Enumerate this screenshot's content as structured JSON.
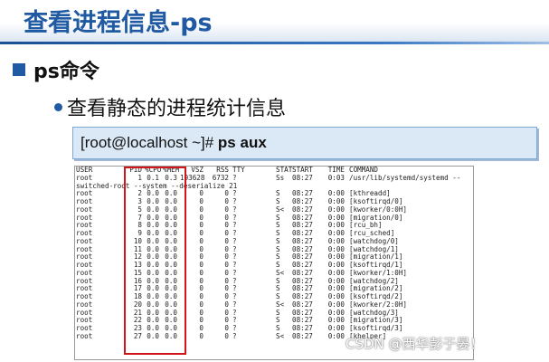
{
  "slide": {
    "title": "查看进程信息-ps",
    "bullet1": "ps命令",
    "bullet2": "查看静态的进程统计信息",
    "command_prefix": "[root@localhost ~]# ",
    "command_strong": "ps aux",
    "watermark": "CSDN @西华彭于晏！"
  },
  "colors": {
    "title_blue": "#1f5aa3",
    "command_box_bg": "#dbe8f6",
    "highlight_red": "#d0161b"
  },
  "terminal": {
    "headers": [
      "USER",
      "PID",
      "%CPU",
      "%MEM",
      "VSZ",
      "RSS",
      "TTY",
      "STAT",
      "START",
      "TIME",
      "COMMAND"
    ],
    "rows": [
      {
        "user": "root",
        "pid": "1",
        "cpu": "0.1",
        "mem": "0.3",
        "vsz": "193628",
        "rss": "6732",
        "tty": "?",
        "stat": "Ss",
        "start": "08:27",
        "time": "0:03",
        "cmd": "/usr/lib/systemd/systemd --"
      },
      {
        "wrap": "switched-root --system --deserialize 21"
      },
      {
        "user": "root",
        "pid": "2",
        "cpu": "0.0",
        "mem": "0.0",
        "vsz": "0",
        "rss": "0",
        "tty": "?",
        "stat": "S",
        "start": "08:27",
        "time": "0:00",
        "cmd": "[kthreadd]"
      },
      {
        "user": "root",
        "pid": "3",
        "cpu": "0.0",
        "mem": "0.0",
        "vsz": "0",
        "rss": "0",
        "tty": "?",
        "stat": "S",
        "start": "08:27",
        "time": "0:00",
        "cmd": "[ksoftirqd/0]"
      },
      {
        "user": "root",
        "pid": "5",
        "cpu": "0.0",
        "mem": "0.0",
        "vsz": "0",
        "rss": "0",
        "tty": "?",
        "stat": "S<",
        "start": "08:27",
        "time": "0:00",
        "cmd": "[kworker/0:0H]"
      },
      {
        "user": "root",
        "pid": "7",
        "cpu": "0.0",
        "mem": "0.0",
        "vsz": "0",
        "rss": "0",
        "tty": "?",
        "stat": "S",
        "start": "08:27",
        "time": "0:00",
        "cmd": "[migration/0]"
      },
      {
        "user": "root",
        "pid": "8",
        "cpu": "0.0",
        "mem": "0.0",
        "vsz": "0",
        "rss": "0",
        "tty": "?",
        "stat": "S",
        "start": "08:27",
        "time": "0:00",
        "cmd": "[rcu_bh]"
      },
      {
        "user": "root",
        "pid": "9",
        "cpu": "0.0",
        "mem": "0.0",
        "vsz": "0",
        "rss": "0",
        "tty": "?",
        "stat": "S",
        "start": "08:27",
        "time": "0:00",
        "cmd": "[rcu_sched]"
      },
      {
        "user": "root",
        "pid": "10",
        "cpu": "0.0",
        "mem": "0.0",
        "vsz": "0",
        "rss": "0",
        "tty": "?",
        "stat": "S",
        "start": "08:27",
        "time": "0:00",
        "cmd": "[watchdog/0]"
      },
      {
        "user": "root",
        "pid": "11",
        "cpu": "0.0",
        "mem": "0.0",
        "vsz": "0",
        "rss": "0",
        "tty": "?",
        "stat": "S",
        "start": "08:27",
        "time": "0:00",
        "cmd": "[watchdog/1]"
      },
      {
        "user": "root",
        "pid": "12",
        "cpu": "0.0",
        "mem": "0.0",
        "vsz": "0",
        "rss": "0",
        "tty": "?",
        "stat": "S",
        "start": "08:27",
        "time": "0:00",
        "cmd": "[migration/1]"
      },
      {
        "user": "root",
        "pid": "13",
        "cpu": "0.0",
        "mem": "0.0",
        "vsz": "0",
        "rss": "0",
        "tty": "?",
        "stat": "S",
        "start": "08:27",
        "time": "0:00",
        "cmd": "[ksoftirqd/1]"
      },
      {
        "user": "root",
        "pid": "15",
        "cpu": "0.0",
        "mem": "0.0",
        "vsz": "0",
        "rss": "0",
        "tty": "?",
        "stat": "S<",
        "start": "08:27",
        "time": "0:00",
        "cmd": "[kworker/1:0H]"
      },
      {
        "user": "root",
        "pid": "16",
        "cpu": "0.0",
        "mem": "0.0",
        "vsz": "0",
        "rss": "0",
        "tty": "?",
        "stat": "S",
        "start": "08:27",
        "time": "0:00",
        "cmd": "[watchdog/2]"
      },
      {
        "user": "root",
        "pid": "17",
        "cpu": "0.0",
        "mem": "0.0",
        "vsz": "0",
        "rss": "0",
        "tty": "?",
        "stat": "S",
        "start": "08:27",
        "time": "0:00",
        "cmd": "[migration/2]"
      },
      {
        "user": "root",
        "pid": "18",
        "cpu": "0.0",
        "mem": "0.0",
        "vsz": "0",
        "rss": "0",
        "tty": "?",
        "stat": "S",
        "start": "08:27",
        "time": "0:00",
        "cmd": "[ksoftirqd/2]"
      },
      {
        "user": "root",
        "pid": "20",
        "cpu": "0.0",
        "mem": "0.0",
        "vsz": "0",
        "rss": "0",
        "tty": "?",
        "stat": "S<",
        "start": "08:27",
        "time": "0:00",
        "cmd": "[kworker/2:0H]"
      },
      {
        "user": "root",
        "pid": "21",
        "cpu": "0.0",
        "mem": "0.0",
        "vsz": "0",
        "rss": "0",
        "tty": "?",
        "stat": "S",
        "start": "08:27",
        "time": "0:00",
        "cmd": "[watchdog/3]"
      },
      {
        "user": "root",
        "pid": "22",
        "cpu": "0.0",
        "mem": "0.0",
        "vsz": "0",
        "rss": "0",
        "tty": "?",
        "stat": "S",
        "start": "08:27",
        "time": "0:00",
        "cmd": "[migration/3]"
      },
      {
        "user": "root",
        "pid": "23",
        "cpu": "0.0",
        "mem": "0.0",
        "vsz": "0",
        "rss": "0",
        "tty": "?",
        "stat": "S",
        "start": "08:27",
        "time": "0:00",
        "cmd": "[ksoftirqd/3]"
      },
      {
        "user": "root",
        "pid": "27",
        "cpu": "0.0",
        "mem": "0.0",
        "vsz": "0",
        "rss": "0",
        "tty": "?",
        "stat": "S<",
        "start": "08:27",
        "time": "0:00",
        "cmd": "[khelper]"
      }
    ]
  }
}
